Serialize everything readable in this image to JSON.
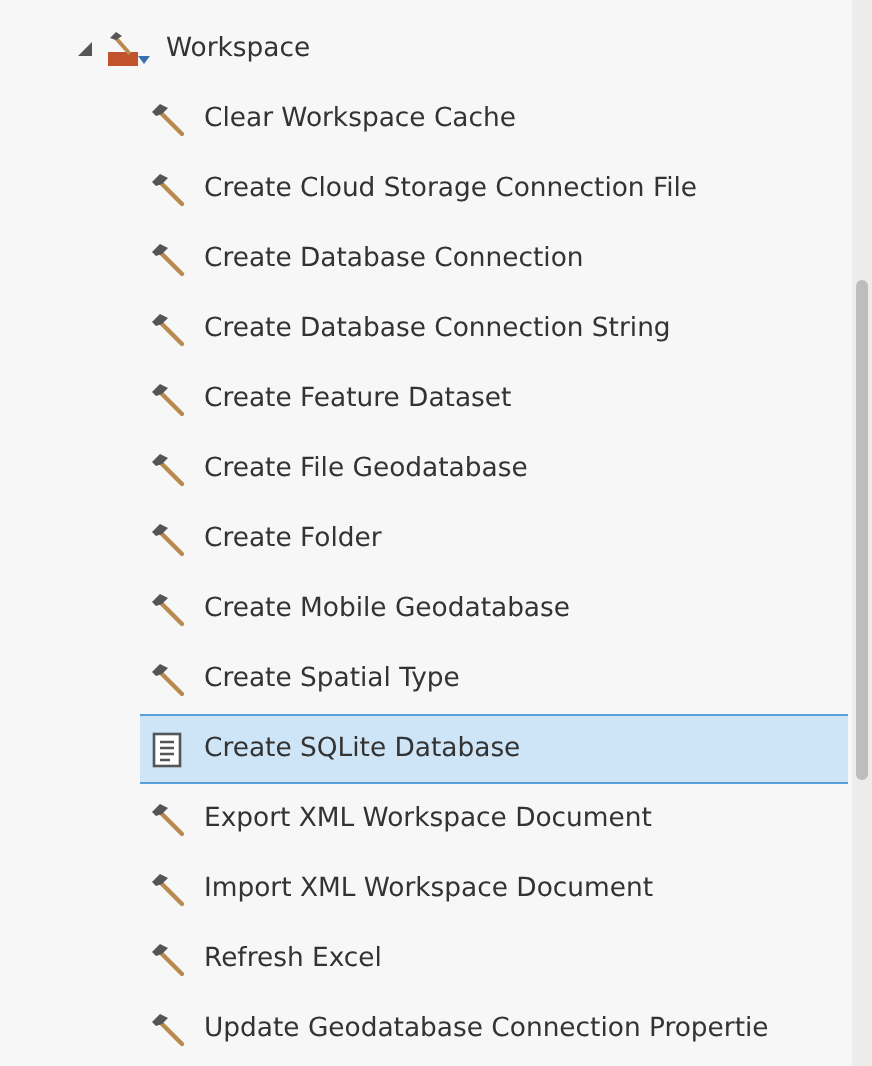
{
  "tree": {
    "label": "Workspace",
    "expanded": true,
    "children": [
      {
        "label": "Clear Workspace Cache",
        "kind": "tool",
        "selected": false
      },
      {
        "label": "Create Cloud Storage Connection File",
        "kind": "tool",
        "selected": false
      },
      {
        "label": "Create Database Connection",
        "kind": "tool",
        "selected": false
      },
      {
        "label": "Create Database Connection String",
        "kind": "tool",
        "selected": false
      },
      {
        "label": "Create Feature Dataset",
        "kind": "tool",
        "selected": false
      },
      {
        "label": "Create File Geodatabase",
        "kind": "tool",
        "selected": false
      },
      {
        "label": "Create Folder",
        "kind": "tool",
        "selected": false
      },
      {
        "label": "Create Mobile Geodatabase",
        "kind": "tool",
        "selected": false
      },
      {
        "label": "Create Spatial Type",
        "kind": "tool",
        "selected": false
      },
      {
        "label": "Create SQLite Database",
        "kind": "script",
        "selected": true
      },
      {
        "label": "Export XML Workspace Document",
        "kind": "tool",
        "selected": false
      },
      {
        "label": "Import XML Workspace Document",
        "kind": "tool",
        "selected": false
      },
      {
        "label": "Refresh Excel",
        "kind": "tool",
        "selected": false
      },
      {
        "label": "Update Geodatabase Connection Propertie",
        "kind": "tool",
        "selected": false
      }
    ]
  }
}
